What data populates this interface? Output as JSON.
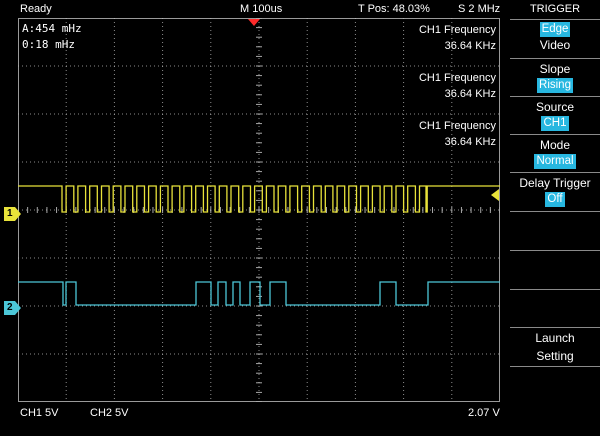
{
  "topbar": {
    "status": "Ready",
    "timebase": "M 100us",
    "tpos": "T Pos: 48.03%",
    "sample": "S 2 MHz"
  },
  "cursor": {
    "line1": "A:454 mHz",
    "line2": "0:18 mHz"
  },
  "measurements": [
    {
      "title": "CH1 Frequency",
      "value": "36.64 KHz"
    },
    {
      "title": "CH1 Frequency",
      "value": "36.64 KHz"
    },
    {
      "title": "CH1 Frequency",
      "value": "36.64 KHz"
    }
  ],
  "channels": {
    "ch1_marker": "1",
    "ch2_marker": "2",
    "ch1_color": "#e8e23a",
    "ch2_color": "#4cc7d8"
  },
  "bottombar": {
    "ch1_scale": "CH1  5V",
    "ch2_scale": "CH2  5V",
    "trigger_level": "2.07 V"
  },
  "sidebar": {
    "title": "TRIGGER",
    "type_selected": "Edge",
    "type_other": "Video",
    "slope_label": "Slope",
    "slope_value": "Rising",
    "source_label": "Source",
    "source_value": "CH1",
    "mode_label": "Mode",
    "mode_value": "Normal",
    "delay_label": "Delay Trigger",
    "delay_value": "Off",
    "launch_label": "Launch",
    "setting_label": "Setting"
  },
  "colors": {
    "accent": "#27b7e0",
    "trigger_marker": "#ff2a2a"
  }
}
